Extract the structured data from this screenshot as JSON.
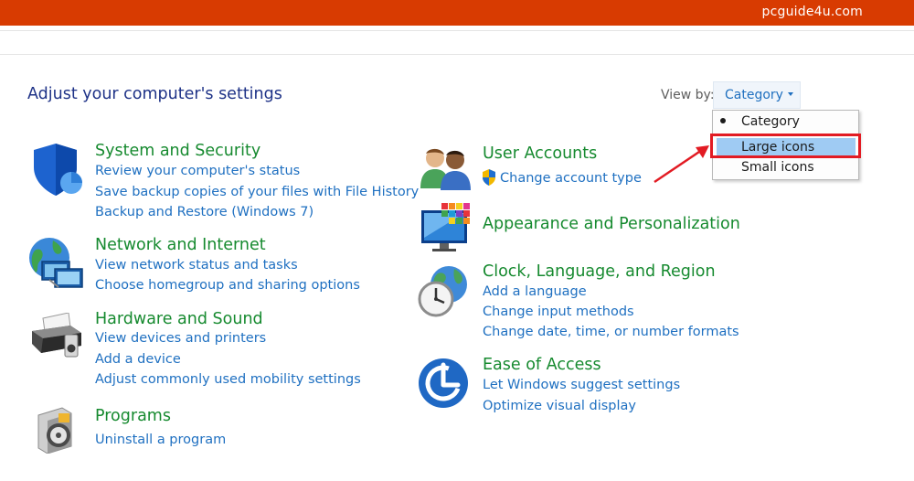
{
  "watermark": "pcguide4u.com",
  "page_title": "Adjust your computer's settings",
  "view_by": {
    "label": "View by:",
    "selected": "Category",
    "options": [
      "Category",
      "Large icons",
      "Small icons"
    ]
  },
  "left_categories": [
    {
      "title": "System and Security",
      "icon": "shield-icon",
      "links": [
        "Review your computer's status",
        "Save backup copies of your files with File History",
        "Backup and Restore (Windows 7)"
      ]
    },
    {
      "title": "Network and Internet",
      "icon": "network-globe-icon",
      "links": [
        "View network status and tasks",
        "Choose homegroup and sharing options"
      ]
    },
    {
      "title": "Hardware and Sound",
      "icon": "printer-icon",
      "links": [
        "View devices and printers",
        "Add a device",
        "Adjust commonly used mobility settings"
      ]
    },
    {
      "title": "Programs",
      "icon": "programs-disc-icon",
      "links": [
        "Uninstall a program"
      ]
    }
  ],
  "right_categories": [
    {
      "title": "User Accounts",
      "icon": "users-icon",
      "links": [
        "Change account type"
      ]
    },
    {
      "title": "Appearance and Personalization",
      "icon": "monitor-icon",
      "links": []
    },
    {
      "title": "Clock, Language, and Region",
      "icon": "clock-globe-icon",
      "links": [
        "Add a language",
        "Change input methods",
        "Change date, time, or number formats"
      ]
    },
    {
      "title": "Ease of Access",
      "icon": "ease-of-access-icon",
      "links": [
        "Let Windows suggest settings",
        "Optimize visual display"
      ]
    }
  ],
  "colors": {
    "top_bar": "#d83b01",
    "category_title": "#168a2f",
    "link": "#1f70c1",
    "page_title": "#1e3287",
    "highlight_box": "#e21b23",
    "dropdown_highlight": "#9fcbf3"
  }
}
